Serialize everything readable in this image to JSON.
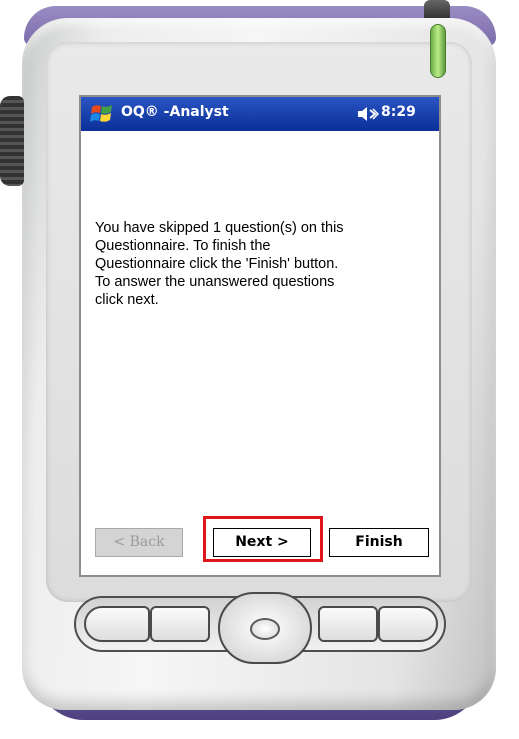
{
  "window": {
    "app_title": "OQ® -Analyst",
    "clock": "8:29",
    "start_icon": "windows-flag-icon",
    "volume_icon": "speaker-icon",
    "title_bar_color": "#0a2f98"
  },
  "message": {
    "lines": [
      "You have skipped 1 question(s) on this",
      "Questionnaire.  To finish the",
      "Questionnaire click the 'Finish' button.",
      "To answer the unanswered questions",
      "click next."
    ]
  },
  "buttons": {
    "back": {
      "label": "< Back",
      "enabled": false
    },
    "next": {
      "label": "Next >",
      "enabled": true,
      "highlighted": true
    },
    "finish": {
      "label": "Finish",
      "enabled": true
    }
  },
  "highlight_color": "#e0151c"
}
